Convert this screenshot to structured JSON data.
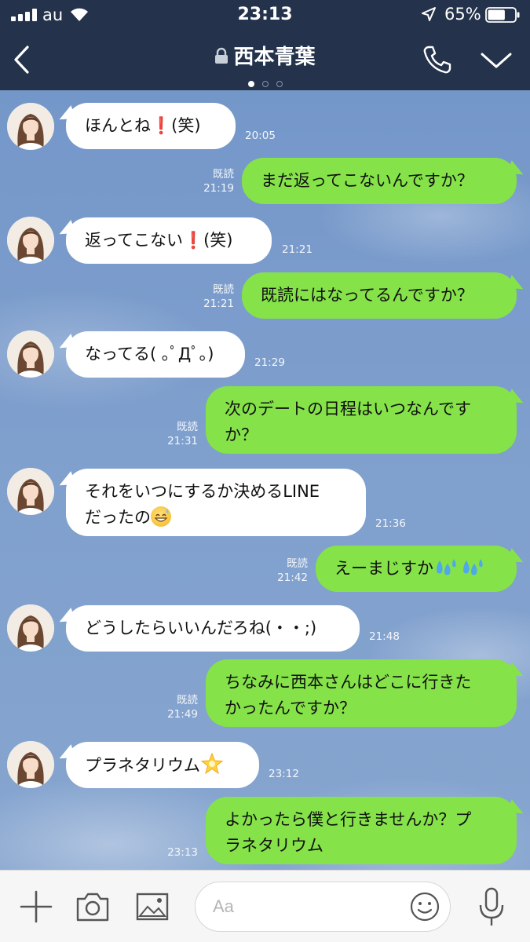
{
  "status_bar": {
    "carrier": "au",
    "time": "23:13",
    "battery_percent": "65%",
    "battery_level": 0.65
  },
  "header": {
    "title": "西本青葉",
    "page_indicator_count": 3,
    "active_page": 1
  },
  "messages": [
    {
      "direction": "in",
      "text": "ほんとね",
      "emoji": "heavy-exclamation-mark",
      "suffix": "(笑)",
      "time": "20:05"
    },
    {
      "direction": "out",
      "text": "まだ返ってこないんですか？",
      "read": "既読",
      "time": "21:19"
    },
    {
      "direction": "in",
      "text": "返ってこない",
      "emoji": "heavy-exclamation-mark",
      "suffix": "(笑)",
      "time": "21:21"
    },
    {
      "direction": "out",
      "text": "既読にはなってるんですか？",
      "read": "既読",
      "time": "21:21"
    },
    {
      "direction": "in",
      "text": "なってる( ｡ﾟДﾟ｡)",
      "time": "21:29"
    },
    {
      "direction": "out",
      "lines": [
        "次のデートの日程はいつなんです",
        "か？"
      ],
      "read": "既読",
      "time": "21:31"
    },
    {
      "direction": "in",
      "lines": [
        "それをいつにするか決めるLINE",
        "だったの"
      ],
      "emoji": "grinning-sweat-face",
      "time": "21:36"
    },
    {
      "direction": "out",
      "text": "えーまじすか",
      "emoji": "sweat-droplets",
      "read": "既読",
      "time": "21:42"
    },
    {
      "direction": "in",
      "text": "どうしたらいいんだろね(・・;)",
      "time": "21:48"
    },
    {
      "direction": "out",
      "lines": [
        "ちなみに西本さんはどこに行きた",
        "かったんですか？"
      ],
      "read": "既読",
      "time": "21:49"
    },
    {
      "direction": "in",
      "text": "プラネタリウム",
      "emoji": "glowing-star",
      "time": "23:12"
    },
    {
      "direction": "out",
      "lines": [
        "よかったら僕と行きませんか？プ",
        "ラネタリウム"
      ],
      "time": "23:13"
    }
  ],
  "input_bar": {
    "placeholder": "Aa"
  },
  "colors": {
    "header_bg": "#24334b",
    "outgoing_bubble": "#85e249",
    "incoming_bubble": "#ffffff",
    "chat_background": "#7d9fcc"
  }
}
